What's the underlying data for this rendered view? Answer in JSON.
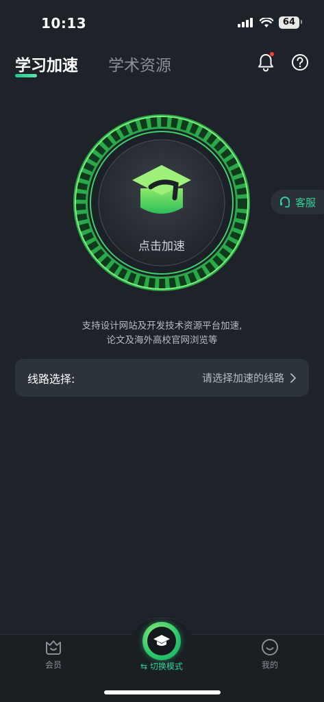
{
  "status_bar": {
    "time": "10:13",
    "battery": "64"
  },
  "header": {
    "tabs": [
      {
        "label": "学习加速",
        "active": true
      },
      {
        "label": "学术资源",
        "active": false
      }
    ],
    "accent_color": "#22c98a"
  },
  "accelerator": {
    "button_label": "点击加速",
    "icon": "graduation-cap-icon"
  },
  "service_button": {
    "label": "客服",
    "icon": "headset-icon"
  },
  "description": {
    "line1": "支持设计网站及开发技术资源平台加速,",
    "line2": "论文及海外高校官网浏览等"
  },
  "route": {
    "label": "线路选择:",
    "value": "请选择加速的线路"
  },
  "bottom_nav": {
    "items": [
      {
        "label": "会员",
        "icon": "vip-icon"
      },
      {
        "label": "切换模式",
        "icon": "graduation-cap-icon"
      },
      {
        "label": "我的",
        "icon": "smile-icon"
      }
    ]
  }
}
